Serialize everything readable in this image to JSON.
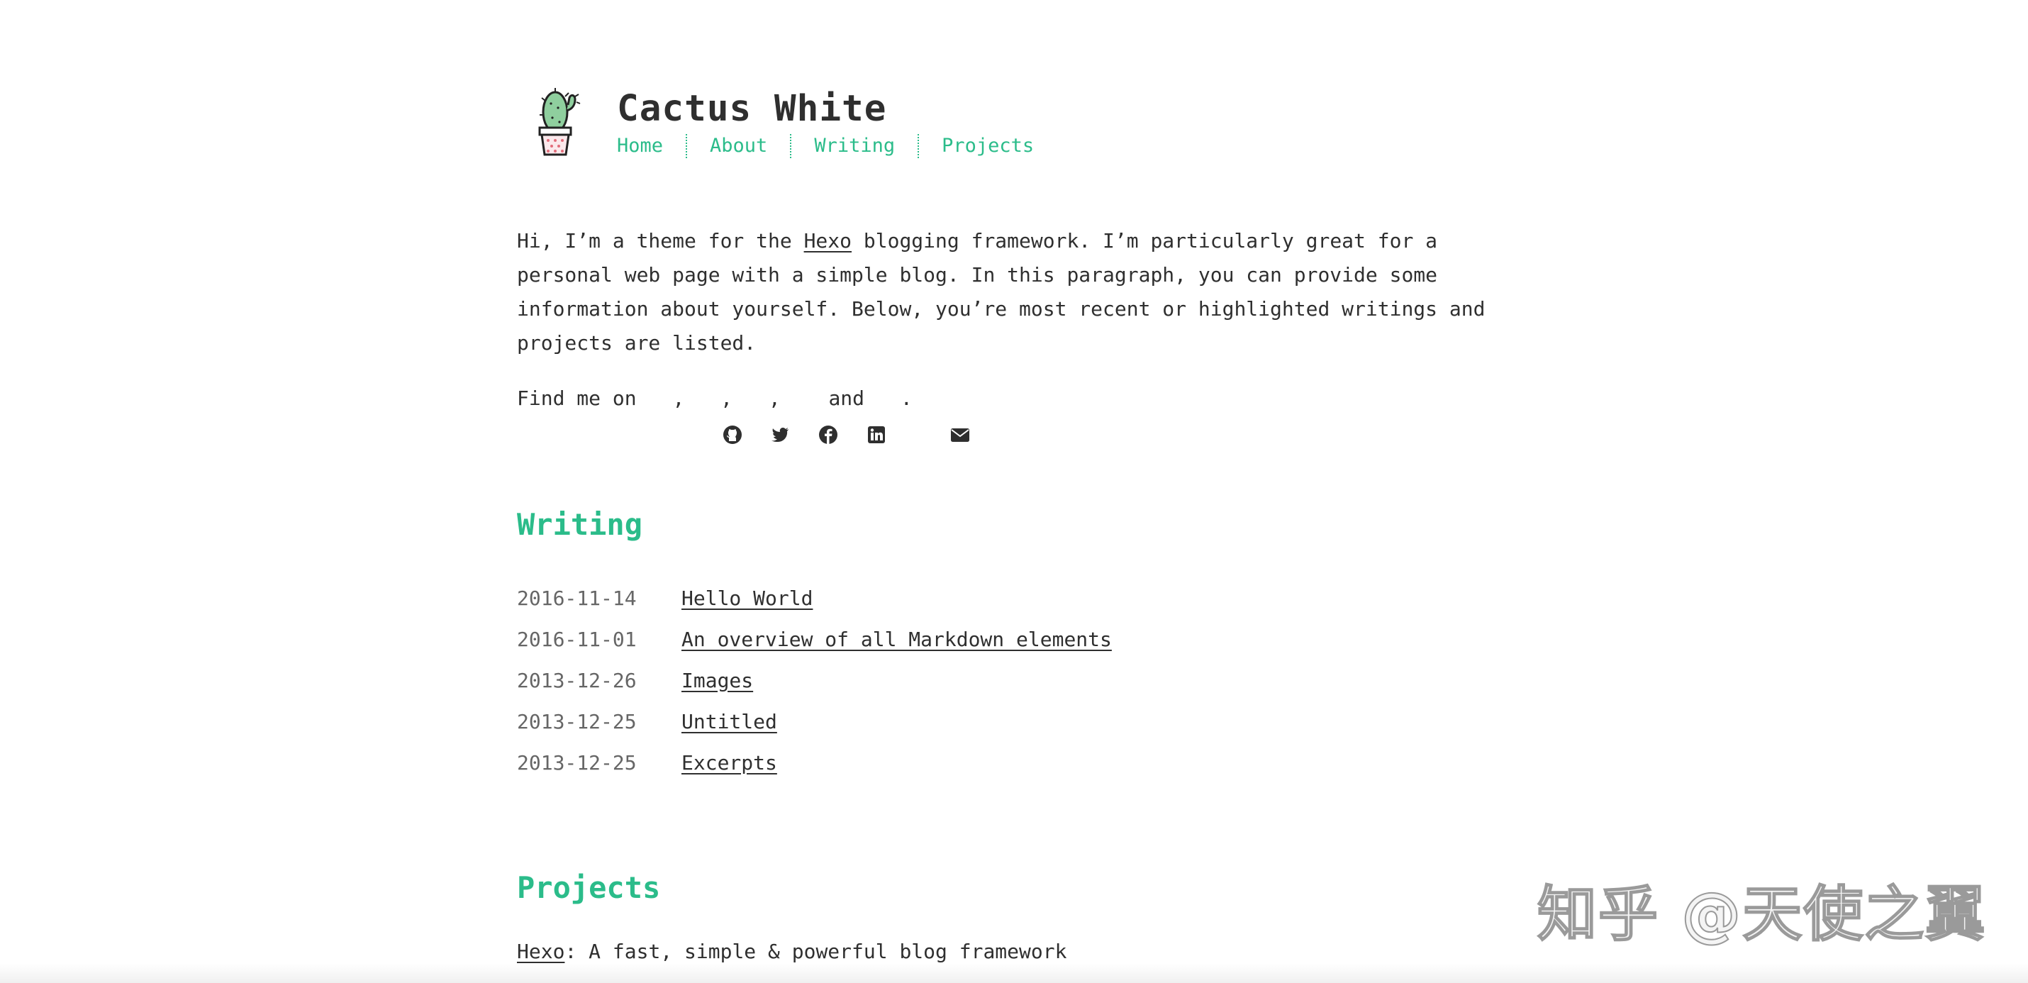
{
  "header": {
    "title": "Cactus White",
    "nav": [
      {
        "label": "Home"
      },
      {
        "label": "About"
      },
      {
        "label": "Writing"
      },
      {
        "label": "Projects"
      }
    ]
  },
  "intro": {
    "pre_link": "Hi, I’m a theme for the ",
    "link": "Hexo",
    "post_link": " blogging framework. I’m particularly great for a personal web page with a simple blog. In this paragraph, you can provide some information about yourself. Below, you’re most recent or highlighted writings and projects are listed."
  },
  "social": {
    "prefix": "Find me on ",
    "sep": ", ",
    "and": " and ",
    "suffix": ".",
    "icons": [
      "github-icon",
      "twitter-icon",
      "facebook-icon",
      "linkedin-icon",
      "envelope-icon"
    ]
  },
  "writing": {
    "title": "Writing",
    "posts": [
      {
        "date": "2016-11-14",
        "title": "Hello World"
      },
      {
        "date": "2016-11-01",
        "title": "An overview of all Markdown elements"
      },
      {
        "date": "2013-12-26",
        "title": "Images"
      },
      {
        "date": "2013-12-25",
        "title": "Untitled"
      },
      {
        "date": "2013-12-25",
        "title": "Excerpts"
      }
    ]
  },
  "projects": {
    "title": "Projects",
    "items": [
      {
        "name": "Hexo",
        "description": ": A fast, simple & powerful blog framework"
      }
    ]
  },
  "watermark": "知乎 @天使之翼",
  "colors": {
    "accent": "#2bbc8a",
    "text": "#2f2f2f",
    "date": "#666666",
    "background": "#ffffff"
  }
}
